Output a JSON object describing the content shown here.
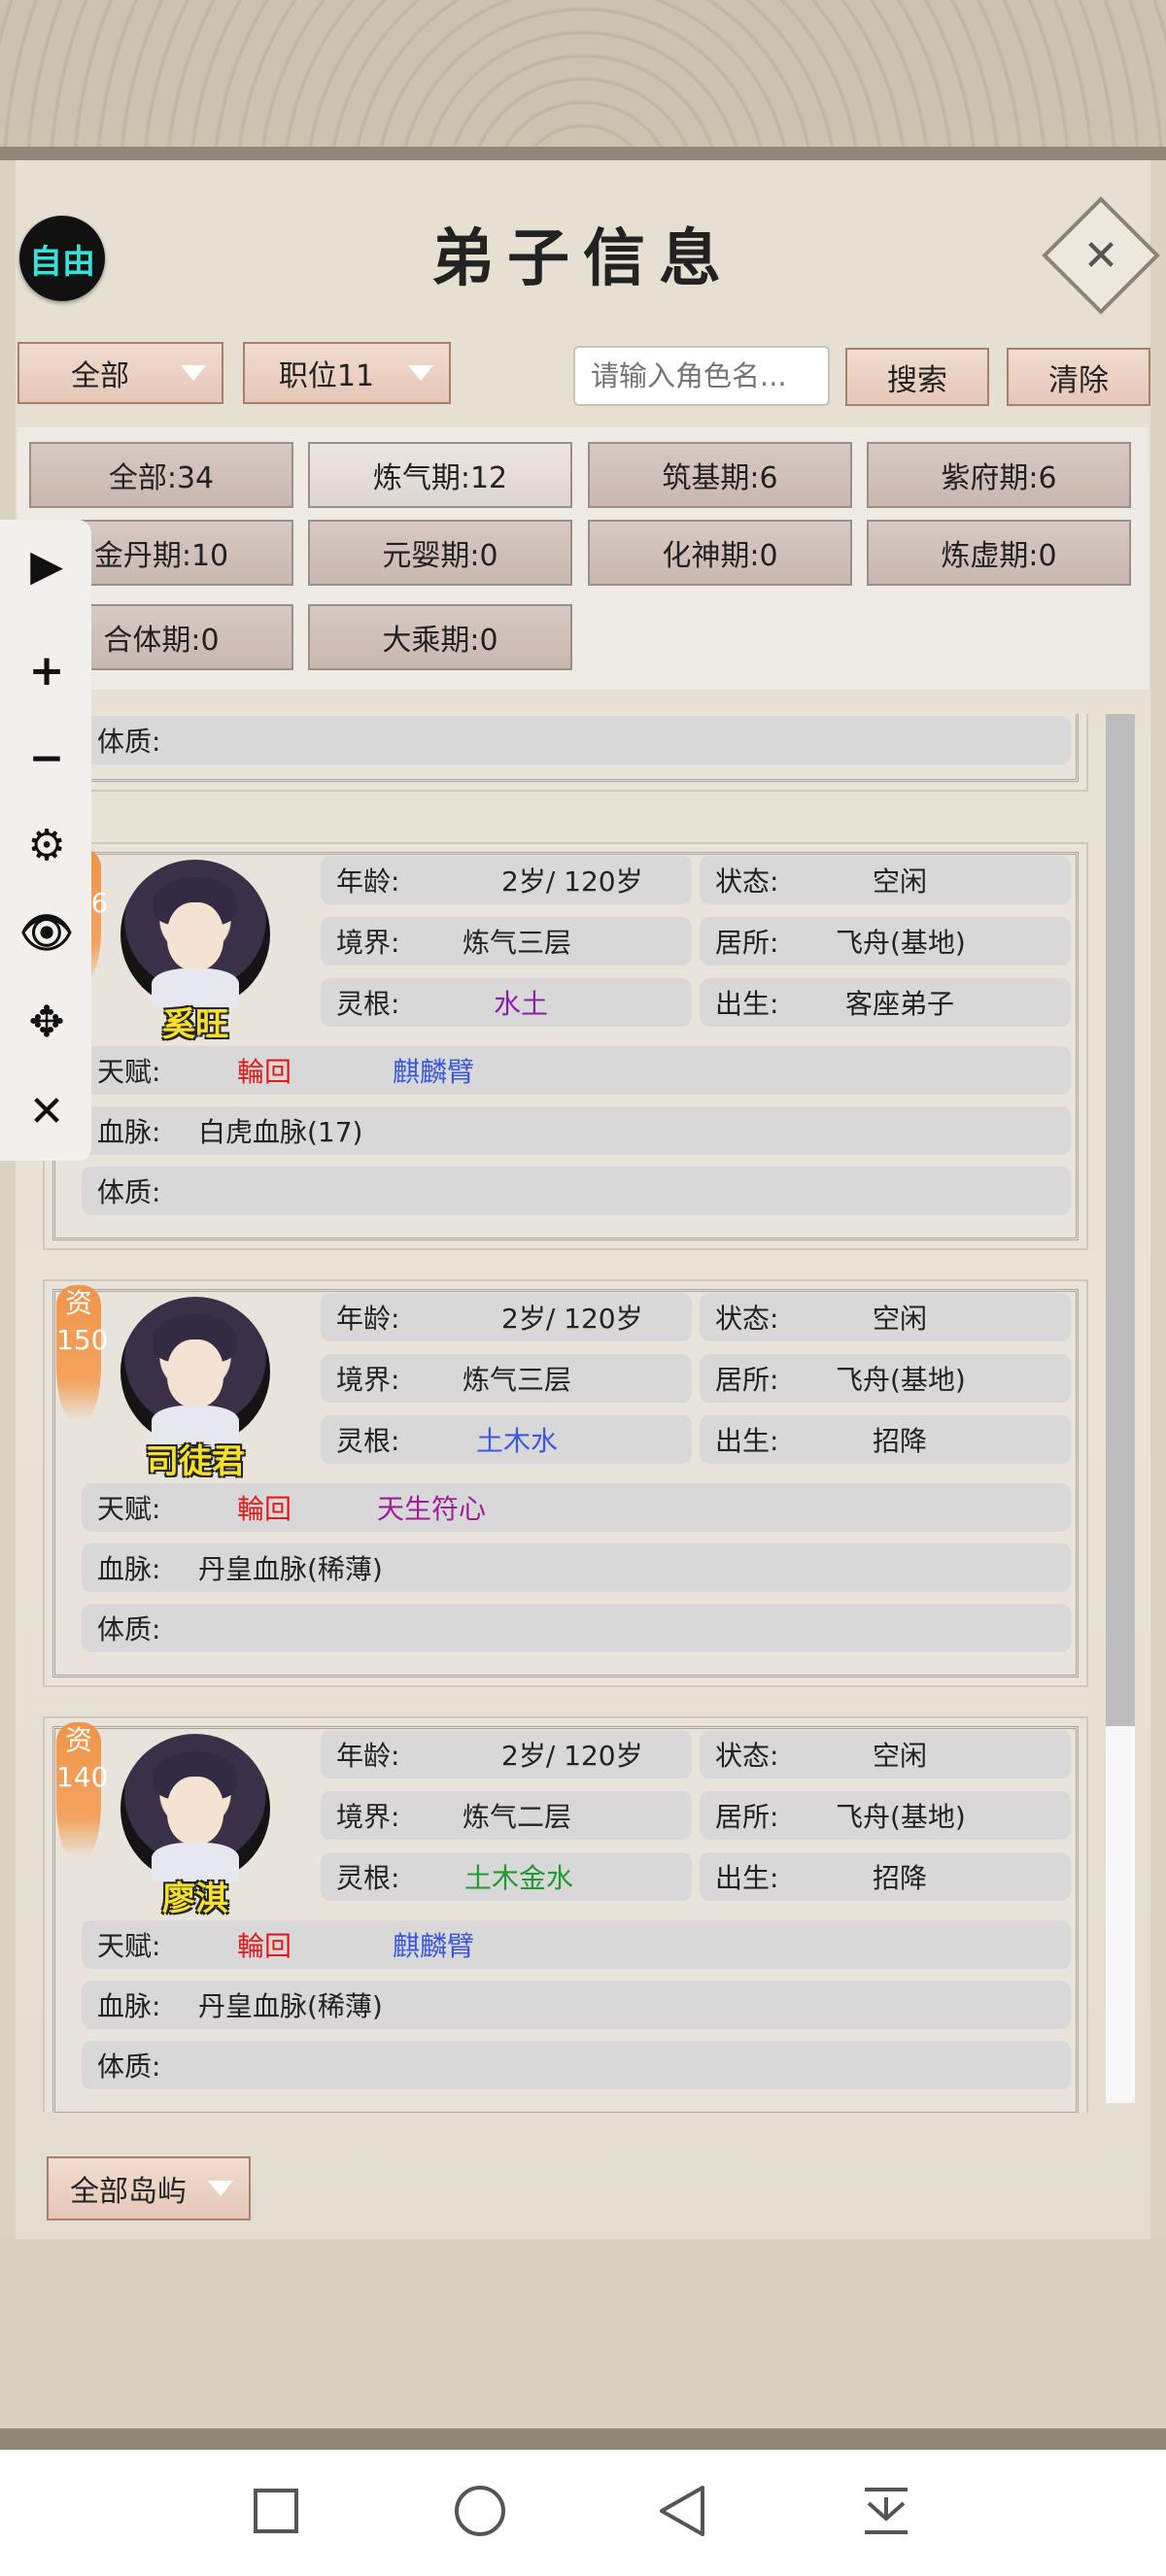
{
  "header": {
    "title": "弟子信息",
    "mode_badge": "自由",
    "close_icon": "close-icon"
  },
  "toolbar": {
    "filter_all": "全部",
    "filter_position": "职位11",
    "search_placeholder": "请输入角色名...",
    "search_label": "搜索",
    "clear_label": "清除"
  },
  "realm_filters": [
    {
      "label": "全部:34"
    },
    {
      "label": "炼气期:12"
    },
    {
      "label": "筑基期:6"
    },
    {
      "label": "紫府期:6"
    },
    {
      "label": "金丹期:10"
    },
    {
      "label": "元婴期:0"
    },
    {
      "label": "化神期:0"
    },
    {
      "label": "炼虚期:0"
    },
    {
      "label": "合体期:0"
    },
    {
      "label": "大乘期:0"
    }
  ],
  "labels": {
    "age": "年龄:",
    "status": "状态:",
    "realm": "境界:",
    "residence": "居所:",
    "root": "灵根:",
    "origin": "出生:",
    "talent": "天赋:",
    "bloodline": "血脉:",
    "physique": "体质:",
    "zi": "资"
  },
  "disciples": [
    {
      "name": "奚旺",
      "aptitude": "206",
      "age": "2岁/ 120岁",
      "status": "空闲",
      "realm": "炼气三层",
      "residence": "飞舟(基地)",
      "root": "水土",
      "root_color": "#8a1fa8",
      "origin": "客座弟子",
      "talent_1": "輪回",
      "talent_1_color": "#e11b1b",
      "talent_2": "麒麟臂",
      "talent_2_color": "#3b57e0",
      "bloodline": "白虎血脉(17)",
      "physique": ""
    },
    {
      "name": "司徒君",
      "aptitude": "150",
      "age": "2岁/ 120岁",
      "status": "空闲",
      "realm": "炼气三层",
      "residence": "飞舟(基地)",
      "root": "土木水",
      "root_color": "#3b57e0",
      "origin": "招降",
      "talent_1": "輪回",
      "talent_1_color": "#e11b1b",
      "talent_2": "天生符心",
      "talent_2_color": "#a11b9a",
      "bloodline": "丹皇血脉(稀薄)",
      "physique": ""
    },
    {
      "name": "廖淇",
      "aptitude": "140",
      "age": "2岁/ 120岁",
      "status": "空闲",
      "realm": "炼气二层",
      "residence": "飞舟(基地)",
      "root": "土木金水",
      "root_color": "#1f9a2e",
      "origin": "招降",
      "talent_1": "輪回",
      "talent_1_color": "#e11b1b",
      "talent_2": "麒麟臂",
      "talent_2_color": "#3b57e0",
      "bloodline": "丹皇血脉(稀薄)",
      "physique": ""
    }
  ],
  "footer": {
    "island_filter": "全部岛屿"
  },
  "side_tools": [
    "play-icon",
    "plus-icon",
    "minus-icon",
    "gear-icon",
    "eye-icon",
    "move-icon",
    "close-icon"
  ],
  "nav": [
    "recent-apps-icon",
    "home-icon",
    "back-icon",
    "notification-pull-icon"
  ]
}
